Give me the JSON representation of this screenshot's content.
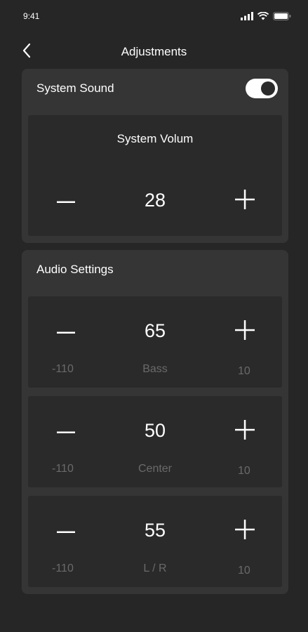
{
  "status": {
    "time": "9:41"
  },
  "nav": {
    "title": "Adjustments"
  },
  "system_sound": {
    "label": "System Sound",
    "toggle_on": true,
    "volume": {
      "title": "System Volum",
      "value": "28"
    }
  },
  "audio_settings": {
    "label": "Audio Settings",
    "controls": [
      {
        "name": "Bass",
        "value": "65",
        "min": "-110",
        "max": "10"
      },
      {
        "name": "Center",
        "value": "50",
        "min": "-110",
        "max": "10"
      },
      {
        "name": "L / R",
        "value": "55",
        "min": "-110",
        "max": "10"
      }
    ]
  },
  "icons": {
    "back": "chevron-left-icon",
    "minus": "minus-icon",
    "plus": "plus-icon",
    "signal": "cellular-signal-icon",
    "wifi": "wifi-icon",
    "battery": "battery-icon"
  },
  "colors": {
    "background": "#262626",
    "panel": "#353535",
    "card": "#2a2a2a",
    "text": "#ffffff",
    "muted_text": "#6a6a6a"
  }
}
